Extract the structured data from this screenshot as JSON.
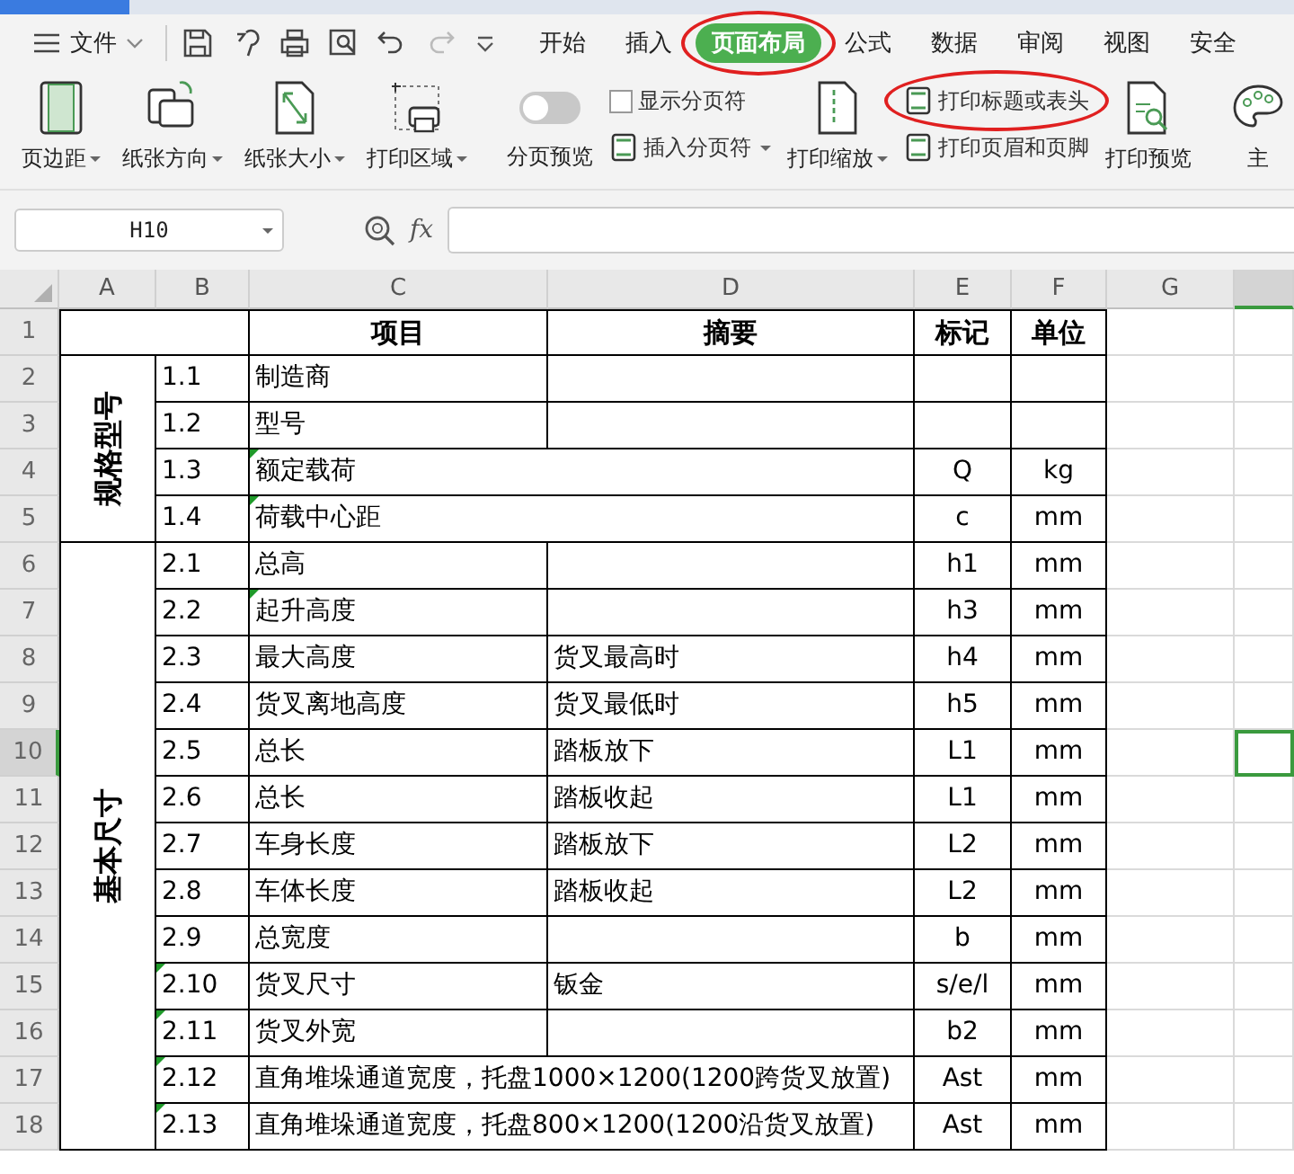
{
  "menu": {
    "file": "文件",
    "tabs": [
      {
        "label": "开始",
        "selected": false,
        "circled": false
      },
      {
        "label": "插入",
        "selected": false,
        "circled": false
      },
      {
        "label": "页面布局",
        "selected": true,
        "circled": true
      },
      {
        "label": "公式",
        "selected": false,
        "circled": false
      },
      {
        "label": "数据",
        "selected": false,
        "circled": false
      },
      {
        "label": "审阅",
        "selected": false,
        "circled": false
      },
      {
        "label": "视图",
        "selected": false,
        "circled": false
      },
      {
        "label": "安全",
        "selected": false,
        "circled": false
      }
    ]
  },
  "ribbon": [
    {
      "kind": "large",
      "label": "页边距",
      "dropdown": true
    },
    {
      "kind": "large",
      "label": "纸张方向",
      "dropdown": true
    },
    {
      "kind": "large",
      "label": "纸张大小",
      "dropdown": true
    },
    {
      "kind": "large",
      "label": "打印区域",
      "dropdown": true
    },
    {
      "kind": "sep"
    },
    {
      "kind": "toggle",
      "label": "分页预览",
      "on": false
    },
    {
      "kind": "stack",
      "rows": [
        {
          "kind": "check",
          "label": "显示分页符",
          "checked": false
        },
        {
          "kind": "small",
          "label": "插入分页符",
          "dropdown": true,
          "circled": false
        }
      ]
    },
    {
      "kind": "large",
      "label": "打印缩放",
      "dropdown": true
    },
    {
      "kind": "stack",
      "rows": [
        {
          "kind": "small",
          "label": "打印标题或表头",
          "dropdown": false,
          "circled": true
        },
        {
          "kind": "small",
          "label": "打印页眉和页脚",
          "dropdown": false,
          "circled": false
        }
      ]
    },
    {
      "kind": "large",
      "label": "打印预览",
      "dropdown": false
    },
    {
      "kind": "sep"
    },
    {
      "kind": "large",
      "label": "主",
      "dropdown": false
    }
  ],
  "formula_bar": {
    "name_box": "H10",
    "fx": "fx"
  },
  "columns": [
    {
      "label": "A",
      "selected": false
    },
    {
      "label": "B",
      "selected": false
    },
    {
      "label": "C",
      "selected": false
    },
    {
      "label": "D",
      "selected": false
    },
    {
      "label": "E",
      "selected": false
    },
    {
      "label": "F",
      "selected": false
    },
    {
      "label": "G",
      "selected": false
    },
    {
      "selected": true
    }
  ],
  "header_row": {
    "num": "1",
    "selected": false,
    "c": "项目",
    "d": "摘要",
    "e": "标记",
    "f": "单位"
  },
  "groups": [
    {
      "label": "规格型号",
      "rows": [
        {
          "num": "2",
          "b": "1.1",
          "c": "制造商",
          "wide": false,
          "b_marked": false,
          "c_marked": false,
          "selected": false
        },
        {
          "num": "3",
          "b": "1.2",
          "c": "型号",
          "wide": false,
          "b_marked": false,
          "c_marked": false,
          "selected": false
        },
        {
          "num": "4",
          "b": "1.3",
          "c": "额定载荷",
          "e": "Q",
          "f": "kg",
          "wide": true,
          "b_marked": false,
          "c_marked": true,
          "selected": false
        },
        {
          "num": "5",
          "b": "1.4",
          "c": "荷载中心距",
          "e": "c",
          "f": "mm",
          "wide": true,
          "b_marked": false,
          "c_marked": true,
          "selected": false
        }
      ]
    },
    {
      "label": "基本尺寸",
      "rows": [
        {
          "num": "6",
          "b": "2.1",
          "c": "总高",
          "e": "h1",
          "f": "mm",
          "wide": false,
          "b_marked": false,
          "c_marked": false,
          "selected": false
        },
        {
          "num": "7",
          "b": "2.2",
          "c": "起升高度",
          "e": "h3",
          "f": "mm",
          "wide": false,
          "b_marked": false,
          "c_marked": true,
          "selected": false
        },
        {
          "num": "8",
          "b": "2.3",
          "c": "最大高度",
          "d": "货叉最高时",
          "e": "h4",
          "f": "mm",
          "wide": false,
          "b_marked": false,
          "c_marked": false,
          "selected": false
        },
        {
          "num": "9",
          "b": "2.4",
          "c": "货叉离地高度",
          "d": "货叉最低时",
          "e": "h5",
          "f": "mm",
          "wide": false,
          "b_marked": false,
          "c_marked": false,
          "selected": false
        },
        {
          "num": "10",
          "b": "2.5",
          "c": "总长",
          "d": "踏板放下",
          "e": "L1",
          "f": "mm",
          "wide": false,
          "b_marked": false,
          "c_marked": false,
          "selected": true
        },
        {
          "num": "11",
          "b": "2.6",
          "c": "总长",
          "d": "踏板收起",
          "e": "L1",
          "f": "mm",
          "wide": false,
          "b_marked": false,
          "c_marked": false,
          "selected": false
        },
        {
          "num": "12",
          "b": "2.7",
          "c": "车身长度",
          "d": "踏板放下",
          "e": "L2",
          "f": "mm",
          "wide": false,
          "b_marked": false,
          "c_marked": false,
          "selected": false
        },
        {
          "num": "13",
          "b": "2.8",
          "c": "车体长度",
          "d": "踏板收起",
          "e": "L2",
          "f": "mm",
          "wide": false,
          "b_marked": false,
          "c_marked": false,
          "selected": false
        },
        {
          "num": "14",
          "b": "2.9",
          "c": "总宽度",
          "e": "b",
          "f": "mm",
          "wide": false,
          "b_marked": false,
          "c_marked": false,
          "selected": false
        },
        {
          "num": "15",
          "b": "2.10",
          "c": "货叉尺寸",
          "d": "钣金",
          "e": "s/e/l",
          "f": "mm",
          "wide": false,
          "b_marked": true,
          "c_marked": false,
          "selected": false
        },
        {
          "num": "16",
          "b": "2.11",
          "c": "货叉外宽",
          "e": "b2",
          "f": "mm",
          "wide": false,
          "b_marked": true,
          "c_marked": false,
          "selected": false
        },
        {
          "num": "17",
          "b": "2.12",
          "c": "直角堆垛通道宽度，托盘1000×1200(1200跨货叉放置)",
          "e": "Ast",
          "f": "mm",
          "wide": true,
          "b_marked": true,
          "c_marked": false,
          "selected": false
        },
        {
          "num": "18",
          "b": "2.13",
          "c": "直角堆垛通道宽度，托盘800×1200(1200沿货叉放置)",
          "e": "Ast",
          "f": "mm",
          "wide": true,
          "b_marked": true,
          "c_marked": false,
          "selected": false
        }
      ]
    }
  ]
}
